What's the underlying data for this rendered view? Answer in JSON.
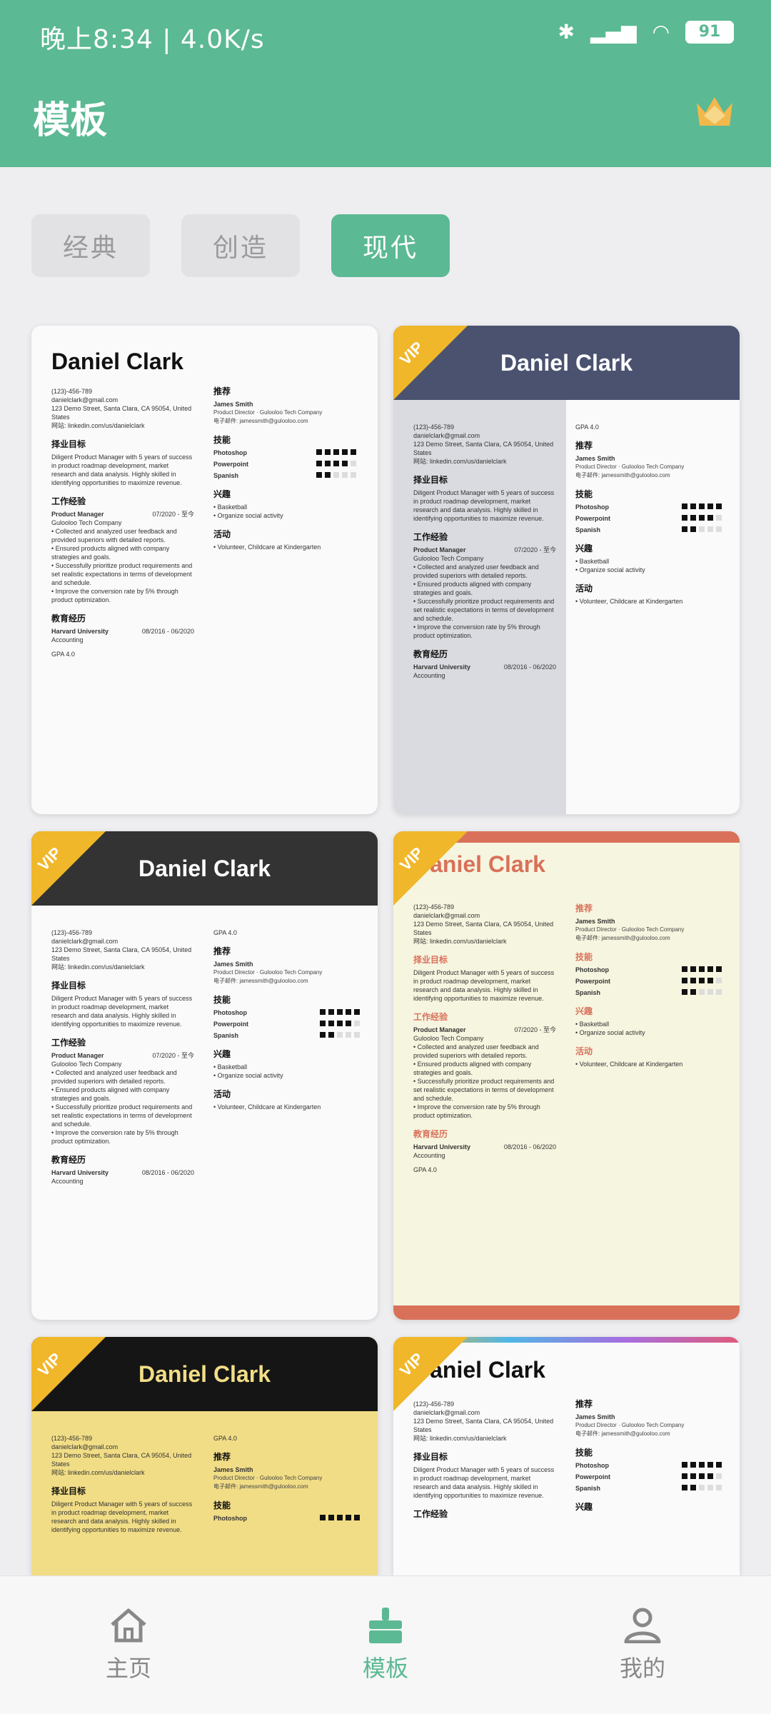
{
  "status_bar": {
    "left": "晚上8:34 | 4.0K/s",
    "battery": "91"
  },
  "appbar": {
    "title": "模板"
  },
  "tabs": [
    {
      "label": "经典"
    },
    {
      "label": "创造"
    },
    {
      "label": "现代"
    }
  ],
  "resume": {
    "name": "Daniel Clark",
    "phone": "(123)-456-789",
    "email": "danielclark@gmail.com",
    "address": "123 Demo Street, Santa Clara, CA 95054, United States",
    "website": "网站: linkedin.com/us/danielclark",
    "sections": {
      "objective": "择业目标",
      "experience": "工作经验",
      "education": "教育经历",
      "reference": "推荐",
      "skills": "技能",
      "interests": "兴趣",
      "activities": "活动"
    },
    "objective_text": "Diligent Product Manager with 5 years of success in product roadmap development, market research and data analysis. Highly skilled in identifying opportunities to maximize revenue.",
    "job_title": "Product Manager",
    "job_dates": "07/2020 - 至今",
    "company": "Gulooloo Tech Company",
    "bullets": "• Collected and analyzed user feedback and provided superiors with detailed reports.\n• Ensured products aligned with company strategies and goals.\n• Successfully prioritize product requirements and set realistic expectations in terms of development and schedule.\n• Improve the conversion rate by 5% through product optimization.",
    "school": "Harvard University",
    "school_dates": "08/2016 - 06/2020",
    "major": "Accounting",
    "gpa": "GPA 4.0",
    "ref_name": "James Smith",
    "ref_role": "Product Director · Gulooloo Tech Company",
    "ref_email": "电子邮件: jamessmith@gulooloo.com",
    "skill_list": [
      {
        "name": "Photoshop",
        "level": 5
      },
      {
        "name": "Powerpoint",
        "level": 4
      },
      {
        "name": "Spanish",
        "level": 2
      }
    ],
    "interest_1": "• Basketball",
    "interest_2": "• Organize social activity",
    "activity": "• Volunteer, Childcare at Kindergarten"
  },
  "vip_label": "VIP",
  "colors": {
    "primary": "#5bb993",
    "vip": "#f0b72a",
    "navy": "#4a5270",
    "dark": "#333333",
    "orange": "#d9715a",
    "black": "#151515",
    "yellow_bg": "#f1dd86"
  },
  "bottom_nav": [
    {
      "label": "主页",
      "icon": "home-icon"
    },
    {
      "label": "模板",
      "icon": "brush-icon"
    },
    {
      "label": "我的",
      "icon": "person-icon"
    }
  ]
}
